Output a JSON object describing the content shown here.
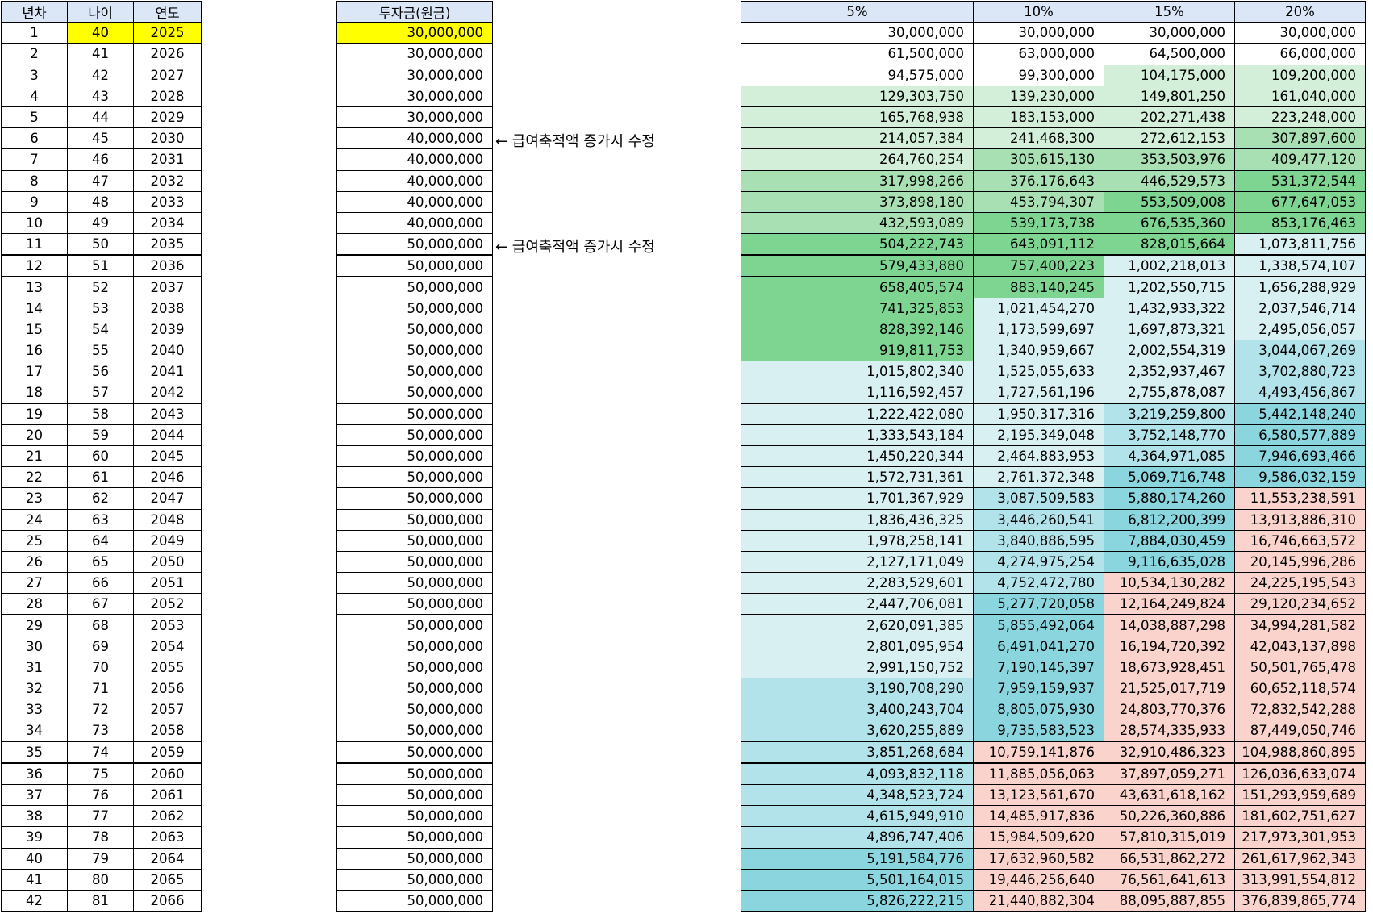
{
  "headers": {
    "year_no": "년차",
    "age": "나이",
    "year": "연도",
    "investment": "투자금(원금)",
    "rates": [
      "5%",
      "10%",
      "15%",
      "20%"
    ]
  },
  "notes": [
    {
      "row": 6,
      "text": "← 급여축적액 증가시 수정"
    },
    {
      "row": 11,
      "text": "← 급여축적액 증가시 수정"
    }
  ],
  "colors": {
    "header": "#dbe6f7",
    "highlight": "#ffff00",
    "green_dark": "#7ed491",
    "green_mid": "#a8e0b3",
    "green_light": "#d3efd9",
    "blue_light": "#d9f0f3",
    "blue_mid": "#b3e3ea",
    "blue_dark": "#8bd5de",
    "pink": "#fad3cd"
  },
  "rows": [
    {
      "n": "1",
      "age": "40",
      "year": "2025",
      "inv": "30,000,000",
      "v": [
        "30,000,000",
        "30,000,000",
        "30,000,000",
        "30,000,000"
      ],
      "c": [
        "w",
        "w",
        "w",
        "w"
      ]
    },
    {
      "n": "2",
      "age": "41",
      "year": "2026",
      "inv": "30,000,000",
      "v": [
        "61,500,000",
        "63,000,000",
        "64,500,000",
        "66,000,000"
      ],
      "c": [
        "w",
        "w",
        "w",
        "w"
      ]
    },
    {
      "n": "3",
      "age": "42",
      "year": "2027",
      "inv": "30,000,000",
      "v": [
        "94,575,000",
        "99,300,000",
        "104,175,000",
        "109,200,000"
      ],
      "c": [
        "w",
        "w",
        "g1",
        "g1"
      ]
    },
    {
      "n": "4",
      "age": "43",
      "year": "2028",
      "inv": "30,000,000",
      "v": [
        "129,303,750",
        "139,230,000",
        "149,801,250",
        "161,040,000"
      ],
      "c": [
        "g1",
        "g1",
        "g1",
        "g1"
      ]
    },
    {
      "n": "5",
      "age": "44",
      "year": "2029",
      "inv": "30,000,000",
      "v": [
        "165,768,938",
        "183,153,000",
        "202,271,438",
        "223,248,000"
      ],
      "c": [
        "g1",
        "g1",
        "g1",
        "g1"
      ]
    },
    {
      "n": "6",
      "age": "45",
      "year": "2030",
      "inv": "40,000,000",
      "v": [
        "214,057,384",
        "241,468,300",
        "272,612,153",
        "307,897,600"
      ],
      "c": [
        "g1",
        "g1",
        "g1",
        "g2"
      ]
    },
    {
      "n": "7",
      "age": "46",
      "year": "2031",
      "inv": "40,000,000",
      "v": [
        "264,760,254",
        "305,615,130",
        "353,503,976",
        "409,477,120"
      ],
      "c": [
        "g1",
        "g2",
        "g2",
        "g2"
      ]
    },
    {
      "n": "8",
      "age": "47",
      "year": "2032",
      "inv": "40,000,000",
      "v": [
        "317,998,266",
        "376,176,643",
        "446,529,573",
        "531,372,544"
      ],
      "c": [
        "g2",
        "g2",
        "g2",
        "g3"
      ]
    },
    {
      "n": "9",
      "age": "48",
      "year": "2033",
      "inv": "40,000,000",
      "v": [
        "373,898,180",
        "453,794,307",
        "553,509,008",
        "677,647,053"
      ],
      "c": [
        "g2",
        "g2",
        "g3",
        "g3"
      ]
    },
    {
      "n": "10",
      "age": "49",
      "year": "2034",
      "inv": "40,000,000",
      "v": [
        "432,593,089",
        "539,173,738",
        "676,535,360",
        "853,176,463"
      ],
      "c": [
        "g2",
        "g3",
        "g3",
        "g3"
      ]
    },
    {
      "n": "11",
      "age": "50",
      "year": "2035",
      "inv": "50,000,000",
      "v": [
        "504,222,743",
        "643,091,112",
        "828,015,664",
        "1,073,811,756"
      ],
      "c": [
        "g3",
        "g3",
        "g3",
        "b1"
      ]
    },
    {
      "n": "12",
      "age": "51",
      "year": "2036",
      "inv": "50,000,000",
      "v": [
        "579,433,880",
        "757,400,223",
        "1,002,218,013",
        "1,338,574,107"
      ],
      "c": [
        "g3",
        "g3",
        "b1",
        "b1"
      ]
    },
    {
      "n": "13",
      "age": "52",
      "year": "2037",
      "inv": "50,000,000",
      "v": [
        "658,405,574",
        "883,140,245",
        "1,202,550,715",
        "1,656,288,929"
      ],
      "c": [
        "g3",
        "g3",
        "b1",
        "b1"
      ]
    },
    {
      "n": "14",
      "age": "53",
      "year": "2038",
      "inv": "50,000,000",
      "v": [
        "741,325,853",
        "1,021,454,270",
        "1,432,933,322",
        "2,037,546,714"
      ],
      "c": [
        "g3",
        "b1",
        "b1",
        "b1"
      ]
    },
    {
      "n": "15",
      "age": "54",
      "year": "2039",
      "inv": "50,000,000",
      "v": [
        "828,392,146",
        "1,173,599,697",
        "1,697,873,321",
        "2,495,056,057"
      ],
      "c": [
        "g3",
        "b1",
        "b1",
        "b1"
      ]
    },
    {
      "n": "16",
      "age": "55",
      "year": "2040",
      "inv": "50,000,000",
      "v": [
        "919,811,753",
        "1,340,959,667",
        "2,002,554,319",
        "3,044,067,269"
      ],
      "c": [
        "g3",
        "b1",
        "b1",
        "b2"
      ]
    },
    {
      "n": "17",
      "age": "56",
      "year": "2041",
      "inv": "50,000,000",
      "v": [
        "1,015,802,340",
        "1,525,055,633",
        "2,352,937,467",
        "3,702,880,723"
      ],
      "c": [
        "b1",
        "b1",
        "b1",
        "b2"
      ]
    },
    {
      "n": "18",
      "age": "57",
      "year": "2042",
      "inv": "50,000,000",
      "v": [
        "1,116,592,457",
        "1,727,561,196",
        "2,755,878,087",
        "4,493,456,867"
      ],
      "c": [
        "b1",
        "b1",
        "b1",
        "b2"
      ]
    },
    {
      "n": "19",
      "age": "58",
      "year": "2043",
      "inv": "50,000,000",
      "v": [
        "1,222,422,080",
        "1,950,317,316",
        "3,219,259,800",
        "5,442,148,240"
      ],
      "c": [
        "b1",
        "b1",
        "b2",
        "b3"
      ]
    },
    {
      "n": "20",
      "age": "59",
      "year": "2044",
      "inv": "50,000,000",
      "v": [
        "1,333,543,184",
        "2,195,349,048",
        "3,752,148,770",
        "6,580,577,889"
      ],
      "c": [
        "b1",
        "b1",
        "b2",
        "b3"
      ]
    },
    {
      "n": "21",
      "age": "60",
      "year": "2045",
      "inv": "50,000,000",
      "v": [
        "1,450,220,344",
        "2,464,883,953",
        "4,364,971,085",
        "7,946,693,466"
      ],
      "c": [
        "b1",
        "b1",
        "b2",
        "b3"
      ]
    },
    {
      "n": "22",
      "age": "61",
      "year": "2046",
      "inv": "50,000,000",
      "v": [
        "1,572,731,361",
        "2,761,372,348",
        "5,069,716,748",
        "9,586,032,159"
      ],
      "c": [
        "b1",
        "b1",
        "b3",
        "b3"
      ]
    },
    {
      "n": "23",
      "age": "62",
      "year": "2047",
      "inv": "50,000,000",
      "v": [
        "1,701,367,929",
        "3,087,509,583",
        "5,880,174,260",
        "11,553,238,591"
      ],
      "c": [
        "b1",
        "b2",
        "b3",
        "p"
      ]
    },
    {
      "n": "24",
      "age": "63",
      "year": "2048",
      "inv": "50,000,000",
      "v": [
        "1,836,436,325",
        "3,446,260,541",
        "6,812,200,399",
        "13,913,886,310"
      ],
      "c": [
        "b1",
        "b2",
        "b3",
        "p"
      ]
    },
    {
      "n": "25",
      "age": "64",
      "year": "2049",
      "inv": "50,000,000",
      "v": [
        "1,978,258,141",
        "3,840,886,595",
        "7,884,030,459",
        "16,746,663,572"
      ],
      "c": [
        "b1",
        "b2",
        "b3",
        "p"
      ]
    },
    {
      "n": "26",
      "age": "65",
      "year": "2050",
      "inv": "50,000,000",
      "v": [
        "2,127,171,049",
        "4,274,975,254",
        "9,116,635,028",
        "20,145,996,286"
      ],
      "c": [
        "b1",
        "b2",
        "b3",
        "p"
      ]
    },
    {
      "n": "27",
      "age": "66",
      "year": "2051",
      "inv": "50,000,000",
      "v": [
        "2,283,529,601",
        "4,752,472,780",
        "10,534,130,282",
        "24,225,195,543"
      ],
      "c": [
        "b1",
        "b2",
        "p",
        "p"
      ]
    },
    {
      "n": "28",
      "age": "67",
      "year": "2052",
      "inv": "50,000,000",
      "v": [
        "2,447,706,081",
        "5,277,720,058",
        "12,164,249,824",
        "29,120,234,652"
      ],
      "c": [
        "b1",
        "b3",
        "p",
        "p"
      ]
    },
    {
      "n": "29",
      "age": "68",
      "year": "2053",
      "inv": "50,000,000",
      "v": [
        "2,620,091,385",
        "5,855,492,064",
        "14,038,887,298",
        "34,994,281,582"
      ],
      "c": [
        "b1",
        "b3",
        "p",
        "p"
      ]
    },
    {
      "n": "30",
      "age": "69",
      "year": "2054",
      "inv": "50,000,000",
      "v": [
        "2,801,095,954",
        "6,491,041,270",
        "16,194,720,392",
        "42,043,137,898"
      ],
      "c": [
        "b1",
        "b3",
        "p",
        "p"
      ]
    },
    {
      "n": "31",
      "age": "70",
      "year": "2055",
      "inv": "50,000,000",
      "v": [
        "2,991,150,752",
        "7,190,145,397",
        "18,673,928,451",
        "50,501,765,478"
      ],
      "c": [
        "b1",
        "b3",
        "p",
        "p"
      ]
    },
    {
      "n": "32",
      "age": "71",
      "year": "2056",
      "inv": "50,000,000",
      "v": [
        "3,190,708,290",
        "7,959,159,937",
        "21,525,017,719",
        "60,652,118,574"
      ],
      "c": [
        "b2",
        "b3",
        "p",
        "p"
      ]
    },
    {
      "n": "33",
      "age": "72",
      "year": "2057",
      "inv": "50,000,000",
      "v": [
        "3,400,243,704",
        "8,805,075,930",
        "24,803,770,376",
        "72,832,542,288"
      ],
      "c": [
        "b2",
        "b3",
        "p",
        "p"
      ]
    },
    {
      "n": "34",
      "age": "73",
      "year": "2058",
      "inv": "50,000,000",
      "v": [
        "3,620,255,889",
        "9,735,583,523",
        "28,574,335,933",
        "87,449,050,746"
      ],
      "c": [
        "b2",
        "b3",
        "p",
        "p"
      ]
    },
    {
      "n": "35",
      "age": "74",
      "year": "2059",
      "inv": "50,000,000",
      "v": [
        "3,851,268,684",
        "10,759,141,876",
        "32,910,486,323",
        "104,988,860,895"
      ],
      "c": [
        "b2",
        "p",
        "p",
        "p"
      ]
    },
    {
      "n": "36",
      "age": "75",
      "year": "2060",
      "inv": "50,000,000",
      "v": [
        "4,093,832,118",
        "11,885,056,063",
        "37,897,059,271",
        "126,036,633,074"
      ],
      "c": [
        "b2",
        "p",
        "p",
        "p"
      ]
    },
    {
      "n": "37",
      "age": "76",
      "year": "2061",
      "inv": "50,000,000",
      "v": [
        "4,348,523,724",
        "13,123,561,670",
        "43,631,618,162",
        "151,293,959,689"
      ],
      "c": [
        "b2",
        "p",
        "p",
        "p"
      ]
    },
    {
      "n": "38",
      "age": "77",
      "year": "2062",
      "inv": "50,000,000",
      "v": [
        "4,615,949,910",
        "14,485,917,836",
        "50,226,360,886",
        "181,602,751,627"
      ],
      "c": [
        "b2",
        "p",
        "p",
        "p"
      ]
    },
    {
      "n": "39",
      "age": "78",
      "year": "2063",
      "inv": "50,000,000",
      "v": [
        "4,896,747,406",
        "15,984,509,620",
        "57,810,315,019",
        "217,973,301,953"
      ],
      "c": [
        "b2",
        "p",
        "p",
        "p"
      ]
    },
    {
      "n": "40",
      "age": "79",
      "year": "2064",
      "inv": "50,000,000",
      "v": [
        "5,191,584,776",
        "17,632,960,582",
        "66,531,862,272",
        "261,617,962,343"
      ],
      "c": [
        "b3",
        "p",
        "p",
        "p"
      ]
    },
    {
      "n": "41",
      "age": "80",
      "year": "2065",
      "inv": "50,000,000",
      "v": [
        "5,501,164,015",
        "19,446,256,640",
        "76,561,641,613",
        "313,991,554,812"
      ],
      "c": [
        "b3",
        "p",
        "p",
        "p"
      ]
    },
    {
      "n": "42",
      "age": "81",
      "year": "2066",
      "inv": "50,000,000",
      "v": [
        "5,826,222,215",
        "21,440,882,304",
        "88,095,887,855",
        "376,839,865,774"
      ],
      "c": [
        "b3",
        "p",
        "p",
        "p"
      ]
    }
  ]
}
